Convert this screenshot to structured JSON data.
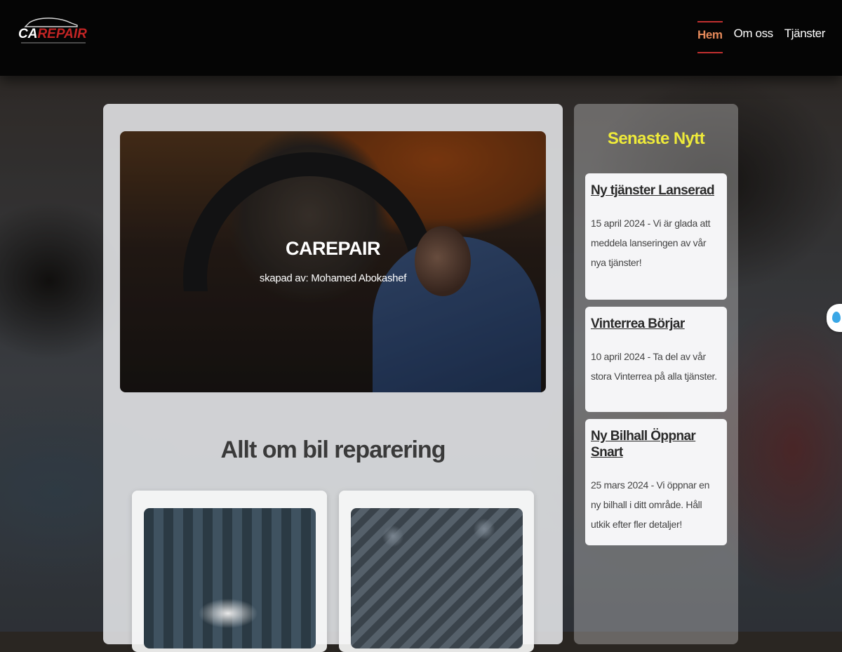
{
  "brand": {
    "logo_part1": "CA",
    "logo_part2": "REPAIR"
  },
  "nav": {
    "items": [
      {
        "label": "Hem",
        "active": true
      },
      {
        "label": "Om oss",
        "active": false
      },
      {
        "label": "Tjänster",
        "active": false
      }
    ]
  },
  "hero": {
    "title": "CAREPAIR",
    "subtitle": "skapad av: Mohamed Abokashef"
  },
  "section": {
    "title": "Allt om bil reparering"
  },
  "news": {
    "heading": "Senaste Nytt",
    "items": [
      {
        "title": "Ny tjänster Lanserad",
        "text": "15 april 2024 - Vi är glada att meddela lanseringen av vår nya tjänster!"
      },
      {
        "title": "Vinterrea Börjar",
        "text": "10 april 2024 - Ta del av vår stora Vinterrea på alla tjänster."
      },
      {
        "title": "Ny Bilhall Öppnar Snart",
        "text": "25 mars 2024 - Vi öppnar en ny bilhall i ditt område. Håll utkik efter fler detaljer!"
      }
    ]
  },
  "colors": {
    "accent_nav": "#e5895a",
    "nav_border": "#c23030",
    "news_heading": "#eeea3a",
    "logo_red": "#c22424"
  }
}
